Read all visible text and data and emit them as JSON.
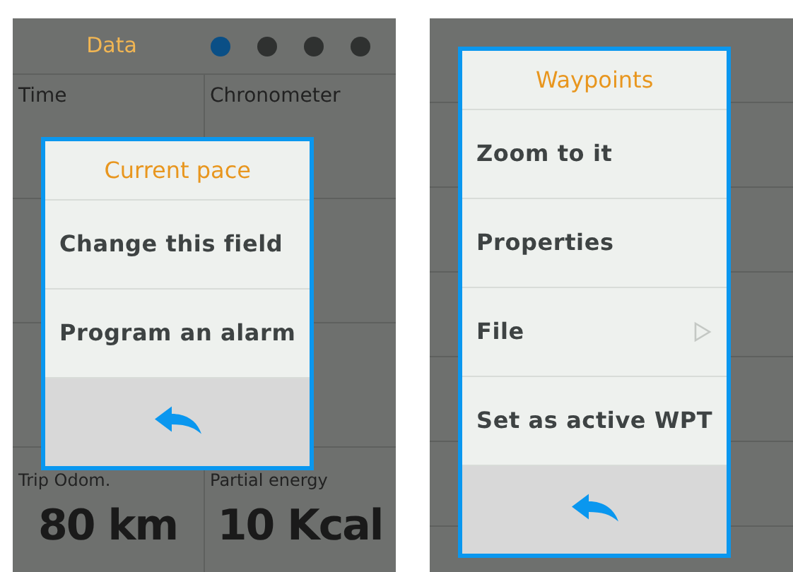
{
  "left_screen": {
    "header": {
      "title": "Data",
      "page_dots": [
        {
          "selected": true
        },
        {
          "selected": false
        },
        {
          "selected": false
        },
        {
          "selected": false
        }
      ]
    },
    "top_fields": [
      {
        "label": "Time"
      },
      {
        "label": "Chronometer"
      }
    ],
    "bottom_fields": [
      {
        "label": "Trip Odom.",
        "value": "80 km"
      },
      {
        "label": "Partial energy",
        "value": "10 Kcal"
      }
    ],
    "dialog": {
      "title": "Current pace",
      "items": [
        {
          "label": "Change this field",
          "submenu": false
        },
        {
          "label": "Program an alarm",
          "submenu": false
        }
      ]
    }
  },
  "right_screen": {
    "dialog": {
      "title": "Waypoints",
      "items": [
        {
          "label": "Zoom to it",
          "submenu": false
        },
        {
          "label": "Properties",
          "submenu": false
        },
        {
          "label": "File",
          "submenu": true
        },
        {
          "label": "Set as active WPT",
          "submenu": false
        }
      ]
    }
  }
}
